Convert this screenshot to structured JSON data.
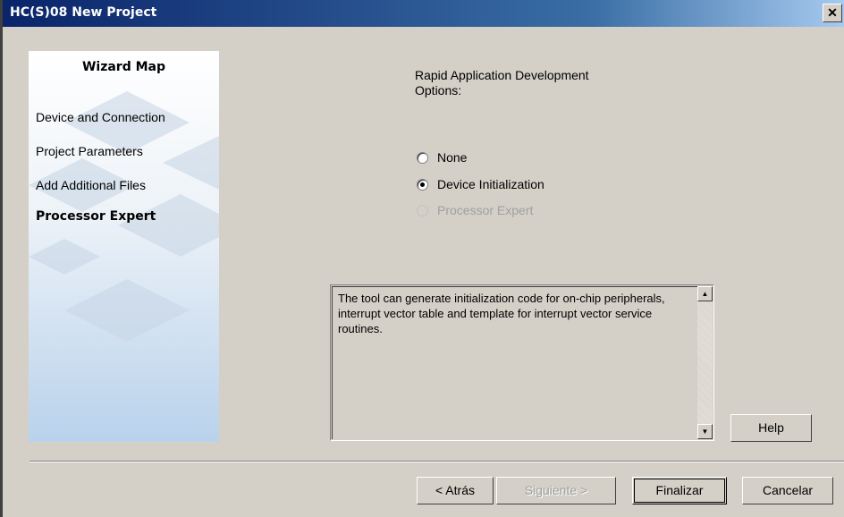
{
  "window": {
    "title": "HC(S)08 New Project",
    "close_glyph": "✕"
  },
  "sidebar": {
    "title": "Wizard Map",
    "items": [
      {
        "label": "Device and Connection"
      },
      {
        "label": "Project Parameters"
      },
      {
        "label": "Add Additional Files"
      },
      {
        "label": "Processor Expert"
      }
    ]
  },
  "options": {
    "label_line1": "Rapid Application Development",
    "label_line2": "Options:",
    "radios": [
      {
        "label": "None",
        "checked": false,
        "disabled": false
      },
      {
        "label": "Device Initialization",
        "checked": true,
        "disabled": false
      },
      {
        "label": "Processor Expert",
        "checked": false,
        "disabled": true
      }
    ]
  },
  "description": {
    "text": "The tool can generate initialization code for on-chip peripherals, interrupt vector table and template for interrupt vector service routines."
  },
  "buttons": {
    "help": "Help",
    "back": "< Atrás",
    "next": "Siguiente >",
    "finish": "Finalizar",
    "cancel": "Cancelar"
  },
  "icons": {
    "scroll_up": "arrow-up-icon",
    "scroll_down": "arrow-down-icon",
    "close": "close-icon"
  }
}
